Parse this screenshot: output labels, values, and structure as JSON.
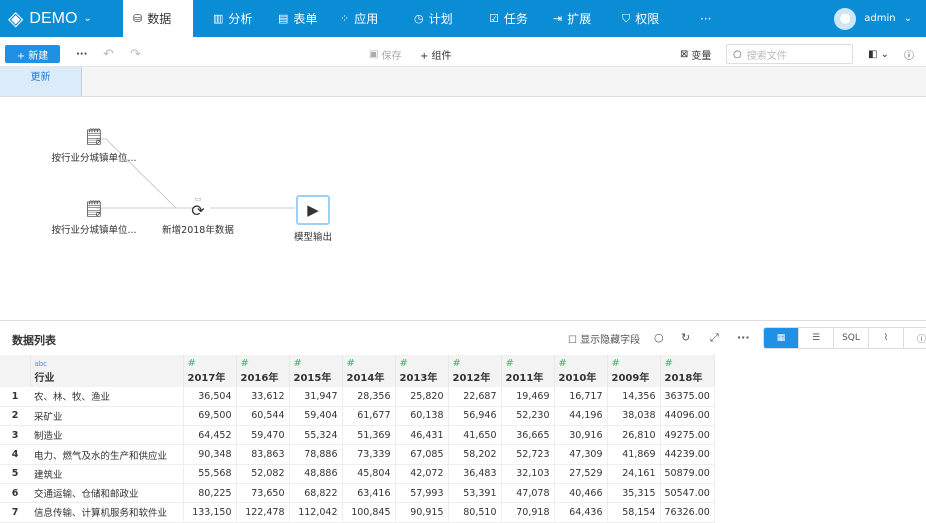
{
  "app": {
    "name": "DEMO",
    "user": "admin"
  },
  "nav": [
    {
      "icon": "database-icon",
      "glyph": "⛁",
      "label": "数据"
    },
    {
      "icon": "bar-chart-icon",
      "glyph": "▥",
      "label": "分析"
    },
    {
      "icon": "form-icon",
      "glyph": "▤",
      "label": "表单"
    },
    {
      "icon": "apps-icon",
      "glyph": "⁘",
      "label": "应用"
    },
    {
      "icon": "clock-icon",
      "glyph": "◷",
      "label": "计划"
    },
    {
      "icon": "task-icon",
      "glyph": "☑",
      "label": "任务"
    },
    {
      "icon": "extension-icon",
      "glyph": "⇥",
      "label": "扩展"
    },
    {
      "icon": "shield-icon",
      "glyph": "⛉",
      "label": "权限"
    }
  ],
  "nav_more": "···",
  "toolbar": {
    "new": "+ 新建",
    "more": "···",
    "undo": "↶",
    "redo": "↷",
    "save": "保存",
    "component": "+ 组件",
    "variables": "变量",
    "search_placeholder": "搜索文件"
  },
  "tabs": [
    "更新"
  ],
  "flow": {
    "nodes": [
      "按行业分城镇单位...",
      "按行业分城镇单位...",
      "新增2018年数据",
      "模型输出"
    ]
  },
  "panel": {
    "title": "数据列表",
    "show_hidden": "显示隐藏字段",
    "view_sql": "SQL"
  },
  "table": {
    "headers": [
      "行业",
      "2017年",
      "2016年",
      "2015年",
      "2014年",
      "2013年",
      "2012年",
      "2011年",
      "2010年",
      "2009年",
      "2018年"
    ],
    "type_text": "abc",
    "type_num": "#",
    "rows": [
      [
        "1",
        "农、林、牧、渔业",
        "36,504",
        "33,612",
        "31,947",
        "28,356",
        "25,820",
        "22,687",
        "19,469",
        "16,717",
        "14,356",
        "36375.00"
      ],
      [
        "2",
        "采矿业",
        "69,500",
        "60,544",
        "59,404",
        "61,677",
        "60,138",
        "56,946",
        "52,230",
        "44,196",
        "38,038",
        "44096.00"
      ],
      [
        "3",
        "制造业",
        "64,452",
        "59,470",
        "55,324",
        "51,369",
        "46,431",
        "41,650",
        "36,665",
        "30,916",
        "26,810",
        "49275.00"
      ],
      [
        "4",
        "电力、燃气及水的生产和供应业",
        "90,348",
        "83,863",
        "78,886",
        "73,339",
        "67,085",
        "58,202",
        "52,723",
        "47,309",
        "41,869",
        "44239.00"
      ],
      [
        "5",
        "建筑业",
        "55,568",
        "52,082",
        "48,886",
        "45,804",
        "42,072",
        "36,483",
        "32,103",
        "27,529",
        "24,161",
        "50879.00"
      ],
      [
        "6",
        "交通运输、仓储和邮政业",
        "80,225",
        "73,650",
        "68,822",
        "63,416",
        "57,993",
        "53,391",
        "47,078",
        "40,466",
        "35,315",
        "50547.00"
      ],
      [
        "7",
        "信息传输、计算机服务和软件业",
        "133,150",
        "122,478",
        "112,042",
        "100,845",
        "90,915",
        "80,510",
        "70,918",
        "64,436",
        "58,154",
        "76326.00"
      ]
    ]
  }
}
